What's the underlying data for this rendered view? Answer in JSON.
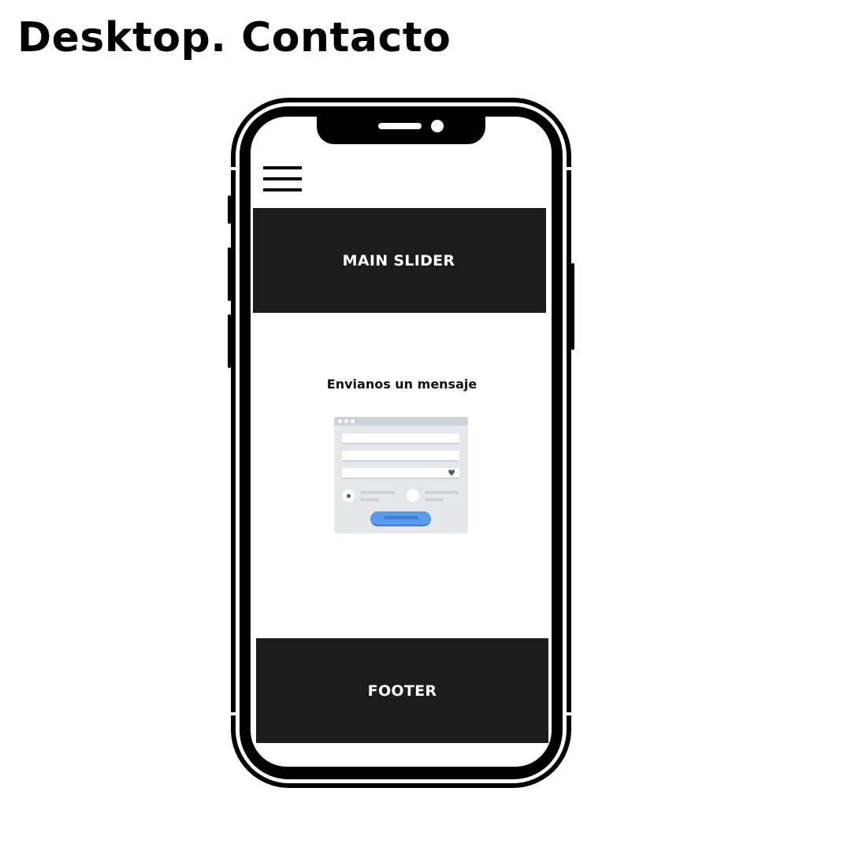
{
  "page": {
    "title": "Desktop. Contacto"
  },
  "mockup": {
    "slider_label": "MAIN SLIDER",
    "contact_heading": "Envianos un mensaje",
    "footer_label": "FOOTER",
    "icons": {
      "menu": "hamburger-menu-icon",
      "heart": "heart-icon"
    },
    "colors": {
      "block": "#1c1c1c",
      "form_background": "#e5e7eb",
      "form_button": "#5b9ae8"
    }
  }
}
